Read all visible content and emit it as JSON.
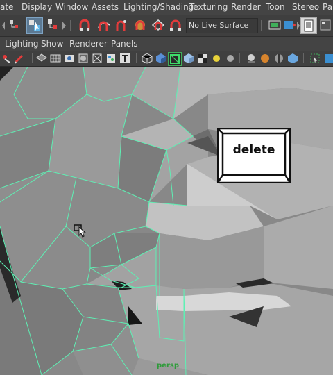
{
  "menubar": {
    "items": [
      "ate",
      "Display",
      "Window",
      "Assets",
      "Lighting/Shading",
      "Texturing",
      "Render",
      "Toon",
      "Stereo",
      "Pa"
    ]
  },
  "shelf": {
    "live_surface": "No Live Surface"
  },
  "panel_menu": {
    "items": [
      "Lighting",
      "Show",
      "Renderer",
      "Panels"
    ]
  },
  "viewport": {
    "camera_label": "persp",
    "overlay_key": "delete"
  }
}
